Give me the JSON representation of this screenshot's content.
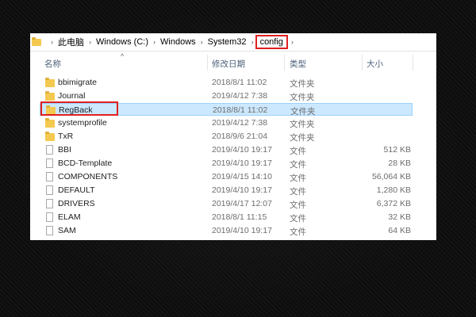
{
  "breadcrumb": {
    "items": [
      "此电脑",
      "Windows (C:)",
      "Windows",
      "System32",
      "config"
    ]
  },
  "columns": {
    "name": "名称",
    "modified": "修改日期",
    "type": "类型",
    "size": "大小"
  },
  "files": [
    {
      "name": "bbimigrate",
      "modified": "2018/8/1 11:02",
      "type": "文件夹",
      "size": "",
      "kind": "folder-icon"
    },
    {
      "name": "Journal",
      "modified": "2019/4/12 7:38",
      "type": "文件夹",
      "size": "",
      "kind": "folder-icon"
    },
    {
      "name": "RegBack",
      "modified": "2018/8/1 11:02",
      "type": "文件夹",
      "size": "",
      "kind": "folder-icon",
      "selected": true
    },
    {
      "name": "systemprofile",
      "modified": "2019/4/12 7:38",
      "type": "文件夹",
      "size": "",
      "kind": "folder-icon"
    },
    {
      "name": "TxR",
      "modified": "2018/9/6 21:04",
      "type": "文件夹",
      "size": "",
      "kind": "folder-icon"
    },
    {
      "name": "BBI",
      "modified": "2019/4/10 19:17",
      "type": "文件",
      "size": "512 KB",
      "kind": "file-icon"
    },
    {
      "name": "BCD-Template",
      "modified": "2019/4/10 19:17",
      "type": "文件",
      "size": "28 KB",
      "kind": "file-icon"
    },
    {
      "name": "COMPONENTS",
      "modified": "2019/4/15 14:10",
      "type": "文件",
      "size": "56,064 KB",
      "kind": "file-icon"
    },
    {
      "name": "DEFAULT",
      "modified": "2019/4/10 19:17",
      "type": "文件",
      "size": "1,280 KB",
      "kind": "file-icon"
    },
    {
      "name": "DRIVERS",
      "modified": "2019/4/17 12:07",
      "type": "文件",
      "size": "6,372 KB",
      "kind": "file-icon"
    },
    {
      "name": "ELAM",
      "modified": "2018/8/1 11:15",
      "type": "文件",
      "size": "32 KB",
      "kind": "file-icon"
    },
    {
      "name": "SAM",
      "modified": "2019/4/10 19:17",
      "type": "文件",
      "size": "64 KB",
      "kind": "file-icon"
    }
  ],
  "colors": {
    "selected_row": "#cce8ff",
    "annotation_red": "#e02020",
    "folder": "#f4c94f"
  }
}
